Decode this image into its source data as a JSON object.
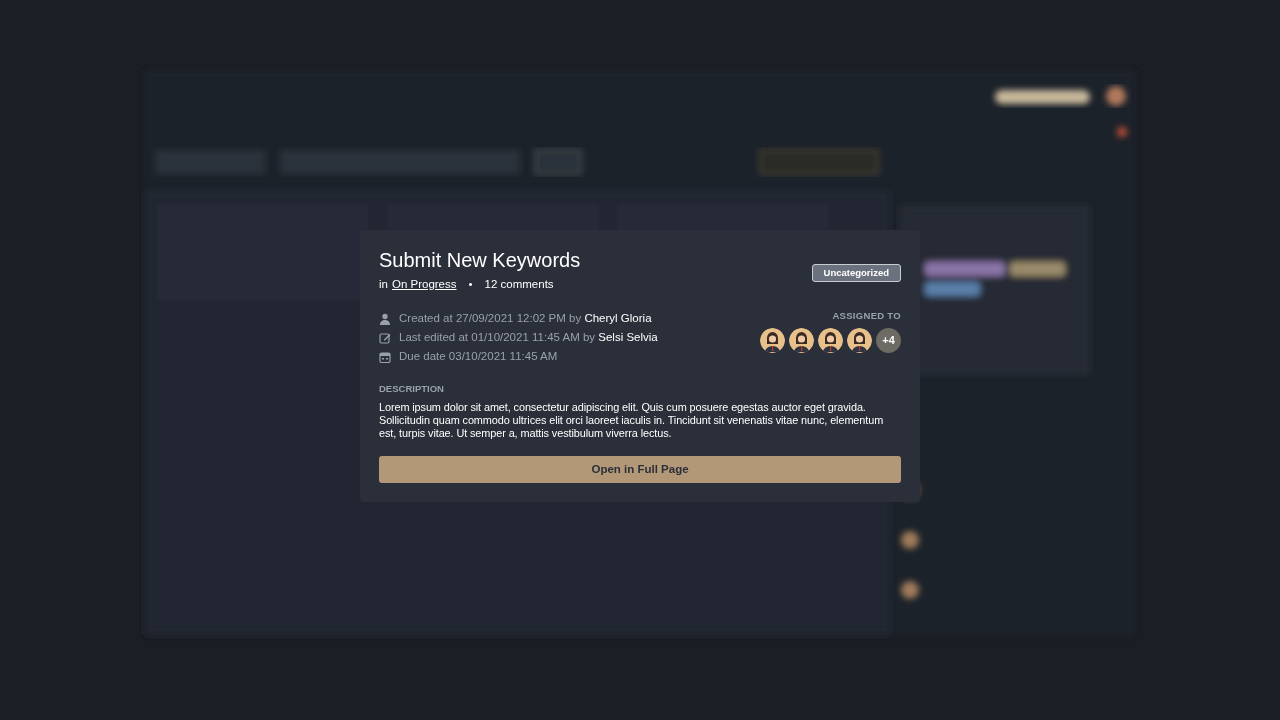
{
  "modal": {
    "title": "Submit New Keywords",
    "list_prefix": "in",
    "list_name": "On Progress",
    "separator": "•",
    "comments": "12 comments",
    "category": "Uncategorized",
    "meta": [
      {
        "kind": "created",
        "text": "Created at 27/09/2021 12:02 PM by",
        "person": "Cheryl Gloria"
      },
      {
        "kind": "edited",
        "text": "Last edited at 01/10/2021 11:45 AM by",
        "person": "Selsi Selvia"
      },
      {
        "kind": "due",
        "text": "Due date 03/10/2021 11:45 AM"
      }
    ],
    "assigned_label": "ASSIGNED TO",
    "assignees": [
      {
        "kind": "avatar"
      },
      {
        "kind": "avatar"
      },
      {
        "kind": "avatar"
      },
      {
        "kind": "avatar"
      },
      {
        "kind": "more",
        "label": "+4"
      }
    ],
    "description_label": "DESCRIPTION",
    "description": "Lorem ipsum dolor sit amet, consectetur adipiscing elit. Quis cum posuere egestas auctor eget gravida. Sollicitudin quam commodo ultrices elit orci laoreet iaculis in. Tincidunt sit venenatis vitae nunc, elementum est, turpis vitae. Ut semper a, mattis vestibulum viverra lectus.",
    "button": "Open in Full Page"
  }
}
